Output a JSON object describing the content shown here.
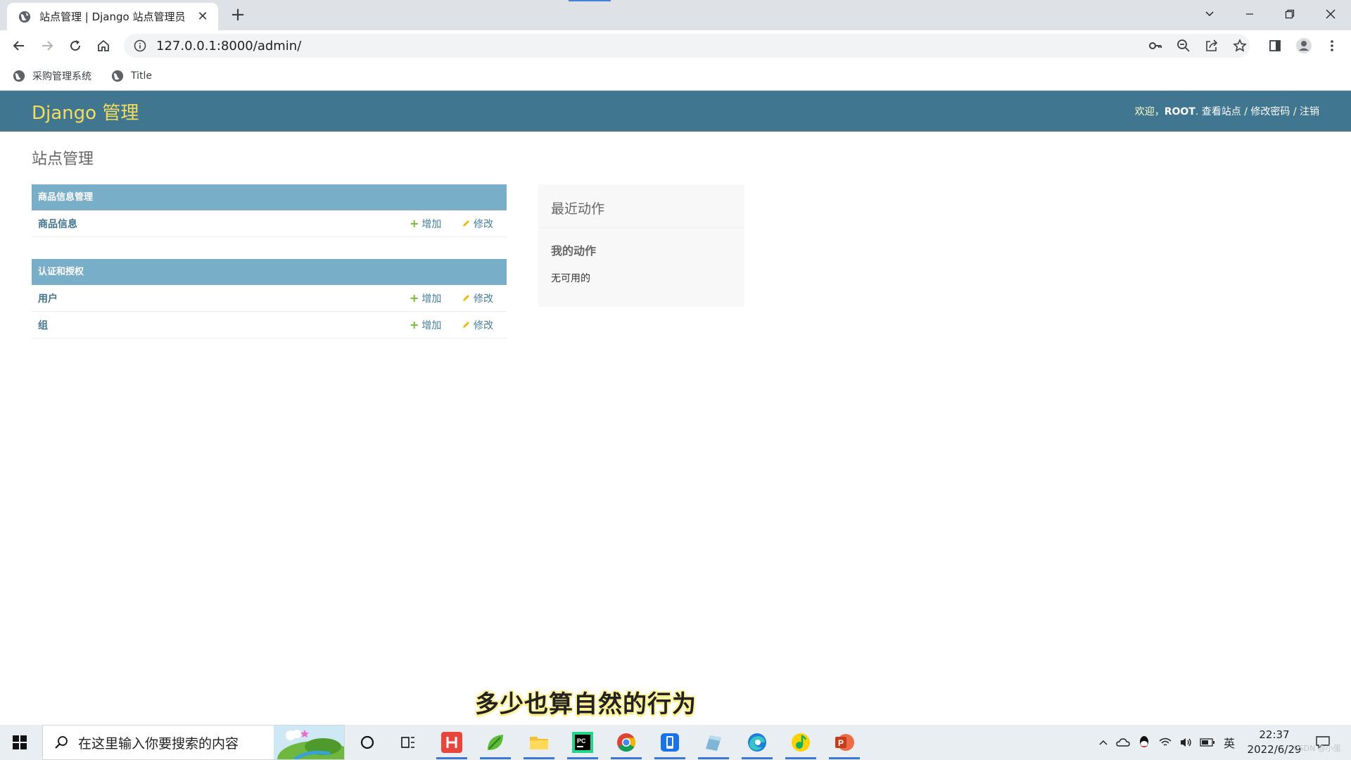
{
  "browser": {
    "tab_title": "站点管理 | Django 站点管理员",
    "new_tab_label": "+",
    "url": "127.0.0.1:8000/admin/",
    "bookmarks": [
      {
        "label": "采购管理系统"
      },
      {
        "label": "Title"
      }
    ]
  },
  "admin": {
    "brand": "Django 管理",
    "user_tools": {
      "welcome": "欢迎，",
      "username": "ROOT",
      "separator_after_user": ". ",
      "view_site": "查看站点",
      "sep1": " / ",
      "change_password": "修改密码",
      "sep2": " / ",
      "logout": "注销"
    },
    "page_title": "站点管理",
    "modules": [
      {
        "caption": "商品信息管理",
        "models": [
          {
            "name": "商品信息",
            "add": "增加",
            "change": "修改"
          }
        ]
      },
      {
        "caption": "认证和授权",
        "models": [
          {
            "name": "用户",
            "add": "增加",
            "change": "修改"
          },
          {
            "name": "组",
            "add": "增加",
            "change": "修改"
          }
        ]
      }
    ],
    "recent_actions": {
      "title": "最近动作",
      "subtitle": "我的动作",
      "empty": "无可用的"
    }
  },
  "video_subtitle": "多少也算自然的行为",
  "taskbar": {
    "search_placeholder": "在这里输入你要搜索的内容",
    "tray_ime": "英",
    "time": "22:37",
    "date": "2022/6/29",
    "watermark": "CSDN @小蛋"
  },
  "colors": {
    "header_bg": "#417690",
    "brand": "#f5dd5d",
    "module_caption_bg": "#79aec8",
    "link": "#417690",
    "add_icon": "#70bf2b",
    "change_icon": "#efb80b"
  }
}
